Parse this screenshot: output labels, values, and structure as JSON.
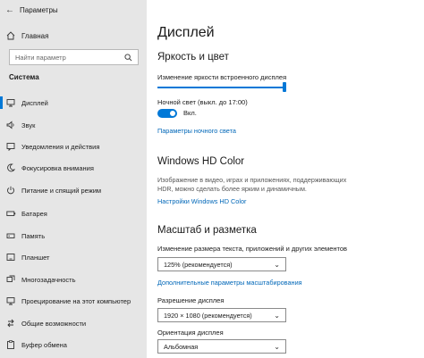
{
  "window": {
    "title": "Параметры"
  },
  "sidebar": {
    "home": "Главная",
    "search_placeholder": "Найти параметр",
    "section": "Система",
    "items": [
      {
        "label": "Дисплей",
        "icon": "monitor-icon"
      },
      {
        "label": "Звук",
        "icon": "speaker-icon"
      },
      {
        "label": "Уведомления и действия",
        "icon": "notifications-icon"
      },
      {
        "label": "Фокусировка внимания",
        "icon": "moon-icon"
      },
      {
        "label": "Питание и спящий режим",
        "icon": "power-icon"
      },
      {
        "label": "Батарея",
        "icon": "battery-icon"
      },
      {
        "label": "Память",
        "icon": "storage-icon"
      },
      {
        "label": "Планшет",
        "icon": "tablet-icon"
      },
      {
        "label": "Многозадачность",
        "icon": "multitasking-icon"
      },
      {
        "label": "Проецирование на этот компьютер",
        "icon": "projecting-icon"
      },
      {
        "label": "Общие возможности",
        "icon": "shared-experiences-icon"
      },
      {
        "label": "Буфер обмена",
        "icon": "clipboard-icon"
      }
    ]
  },
  "main": {
    "title": "Дисплей",
    "brightness": {
      "heading": "Яркость и цвет",
      "label": "Изменение яркости встроенного дисплея",
      "value": 1.0
    },
    "night_light": {
      "label": "Ночной свет (выкл. до 17:00)",
      "state": "Вкл.",
      "settings_link": "Параметры ночного света"
    },
    "hd_color": {
      "heading": "Windows HD Color",
      "description": "Изображение в видео, играх и приложениях, поддерживающих HDR, можно сделать более ярким и динамичным.",
      "settings_link": "Настройки Windows HD Color"
    },
    "scale": {
      "heading": "Масштаб и разметка",
      "label": "Изменение размера текста, приложений и других элементов",
      "value": "125% (рекомендуется)",
      "advanced_link": "Дополнительные параметры масштабирования"
    },
    "resolution": {
      "label": "Разрешение дисплея",
      "value": "1920 × 1080 (рекомендуется)"
    },
    "orientation": {
      "label": "Ориентация дисплея",
      "value": "Альбомная"
    }
  },
  "colors": {
    "accent": "#0078d7",
    "link": "#0067b8",
    "sidebar_bg": "#e6e6e6"
  }
}
